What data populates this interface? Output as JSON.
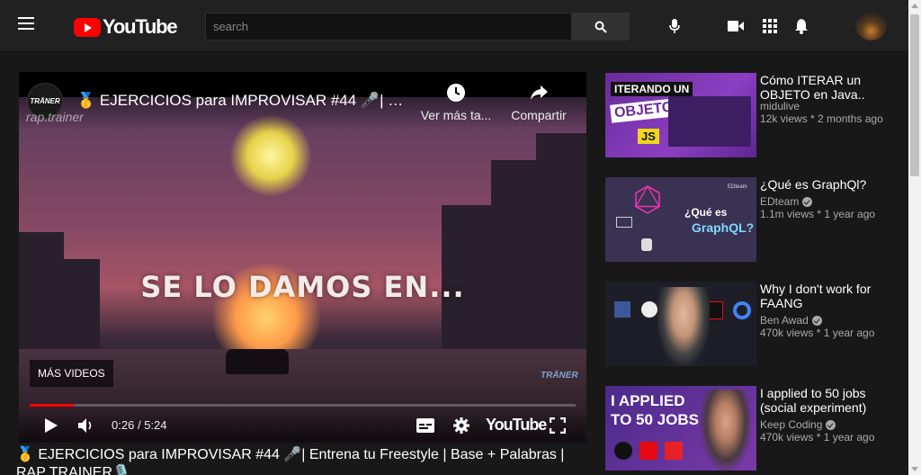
{
  "header": {
    "logo_text": "YouTube",
    "search_placeholder": "search",
    "icons": [
      "menu-icon",
      "search-icon",
      "microphone-icon",
      "video-camera-icon",
      "apps-grid-icon",
      "bell-icon"
    ]
  },
  "player": {
    "channel_avatar_text": "TRÄNER",
    "title": "🥇 EJERCICIOS para IMPROVISAR #44 🎤| Entrena tu Freestyle | Base + Palabras | RAP TRAINER🎙️",
    "watermark": "rap.trainer",
    "watch_later_label": "Ver más ta...",
    "share_label": "Compartir",
    "video_caption": "SE LO DAMOS EN...",
    "more_videos_label": "MÁS VIDEOS",
    "brand_watermark": "TRÄNER",
    "current_time": "0:26",
    "time_separator": "/",
    "duration": "5:24",
    "progress_fraction": 0.08,
    "yt_label": "YouTube"
  },
  "video_title": "🥇 EJERCICIOS para IMPROVISAR #44 🎤| Entrena tu Freestyle | Base + Palabras | RAP TRAINER🎙️",
  "recommendations": [
    {
      "title": "Cómo ITERAR un OBJETO en Java..",
      "channel": "midulive",
      "verified": false,
      "meta": "12k views * 2 months ago",
      "thumb_text_1": "ITERANDO UN",
      "thumb_text_2": "OBJETO",
      "thumb_text_3": "JS"
    },
    {
      "title": "¿Qué es GraphQl?",
      "channel": "EDteam",
      "verified": true,
      "meta": "1.1m views * 1 year ago",
      "thumb_text_1": "¿Qué es",
      "thumb_text_2": "GraphQL?",
      "thumb_text_3": "EDteam"
    },
    {
      "title": "Why I don't work for FAANG",
      "channel": "Ben Awad",
      "verified": true,
      "meta": "470k views * 1 year ago"
    },
    {
      "title": "I applied to 50 jobs (social experiment)",
      "channel": "Keep Coding",
      "verified": true,
      "meta": "470k views * 1 year ago",
      "thumb_text_1": "I APPLIED",
      "thumb_text_2": "TO 50 JOBS"
    }
  ],
  "colors": {
    "background": "#181818",
    "header": "#212121",
    "accent": "#ff0000",
    "secondary_text": "#aaaaaa"
  }
}
